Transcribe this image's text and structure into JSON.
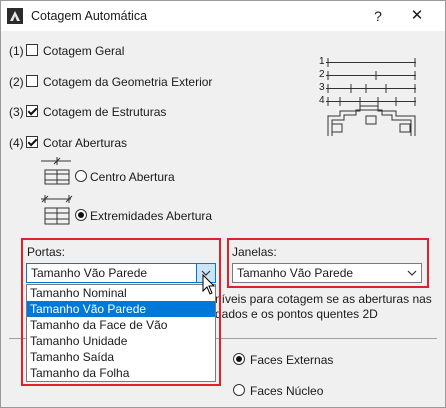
{
  "window": {
    "title": "Cotagem Automática",
    "help": "?",
    "close": "✕"
  },
  "options": [
    {
      "num": "(1)",
      "label": "Cotagem Geral",
      "checked": false
    },
    {
      "num": "(2)",
      "label": "Cotagem da Geometria Exterior",
      "checked": false
    },
    {
      "num": "(3)",
      "label": "Cotagem de Estruturas",
      "checked": true
    },
    {
      "num": "(4)",
      "label": "Cotar Aberturas",
      "checked": true
    }
  ],
  "preview_numbers": [
    "1",
    "2",
    "3",
    "4"
  ],
  "openings": {
    "centro": "Centro Abertura",
    "extremidades": "Extremidades Abertura",
    "selected": "extremidades"
  },
  "portas": {
    "label": "Portas:",
    "value": "Tamanho Vão Parede",
    "options": [
      "Tamanho Nominal",
      "Tamanho Vão Parede",
      "Tamanho da Face de Vão",
      "Tamanho Unidade",
      "Tamanho Saída",
      "Tamanho da Folha"
    ],
    "selected_index": 1
  },
  "janelas": {
    "label": "Janelas:",
    "value": "Tamanho Vão Parede"
  },
  "hidden_text": {
    "line1": "níveis para cotagem se as aberturas nas",
    "line2": "dados e os pontos quentes 2D"
  },
  "faces": {
    "externas": "Faces Externas",
    "nucleo": "Faces Núcleo",
    "selected": "externas"
  }
}
